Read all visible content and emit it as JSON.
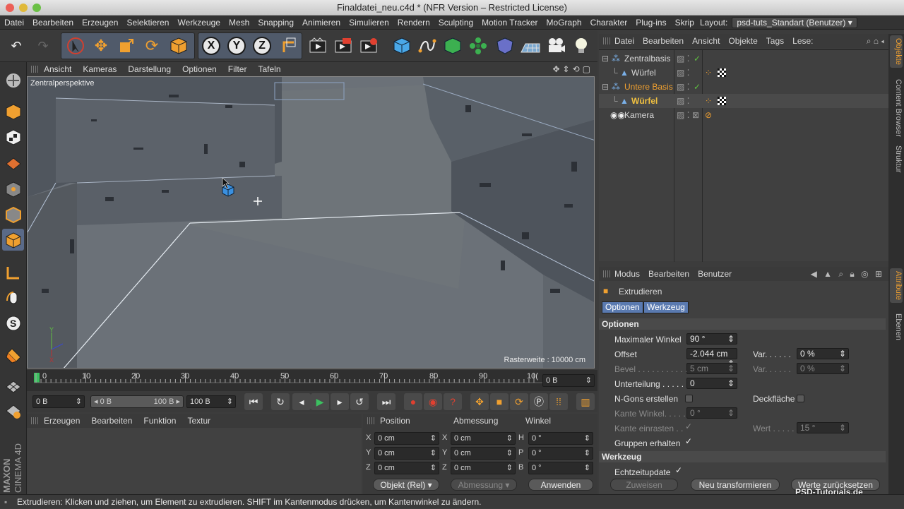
{
  "window": {
    "title": "Finaldatei_neu.c4d * (NFR Version – Restricted License)"
  },
  "menubar": {
    "items": [
      "Datei",
      "Bearbeiten",
      "Erzeugen",
      "Selektieren",
      "Werkzeuge",
      "Mesh",
      "Snapping",
      "Animieren",
      "Simulieren",
      "Rendern",
      "Sculpting",
      "Motion Tracker",
      "MoGraph",
      "Charakter",
      "Plug-ins",
      "Skrip"
    ],
    "layout_label": "Layout:",
    "layout_value": "psd-tuts_Standart (Benutzer)"
  },
  "toolbar": {
    "x": "X",
    "y": "Y",
    "z": "Z"
  },
  "viewport": {
    "menu": [
      "Ansicht",
      "Kameras",
      "Darstellung",
      "Optionen",
      "Filter",
      "Tafeln"
    ],
    "camera_label": "Zentralperspektive",
    "grid_label": "Rasterweite : 10000 cm"
  },
  "timeline": {
    "ticks": [
      "0",
      "10",
      "20",
      "30",
      "40",
      "50",
      "60",
      "70",
      "80",
      "90",
      "10("
    ],
    "current_frame": "0 B",
    "start_field": "0 B",
    "range_start": "◂ 0 B",
    "range_end": "100 B ▸",
    "end_field": "100 B"
  },
  "material_manager": {
    "menu": [
      "Erzeugen",
      "Bearbeiten",
      "Funktion",
      "Textur"
    ]
  },
  "coordinates": {
    "headers": [
      "Position",
      "Abmessung",
      "Winkel"
    ],
    "rows": [
      {
        "a": "X",
        "av": "0 cm",
        "b": "X",
        "bv": "0 cm",
        "c": "H",
        "cv": "0 °"
      },
      {
        "a": "Y",
        "av": "0 cm",
        "b": "Y",
        "bv": "0 cm",
        "c": "P",
        "cv": "0 °"
      },
      {
        "a": "Z",
        "av": "0 cm",
        "b": "Z",
        "bv": "0 cm",
        "c": "B",
        "cv": "0 °"
      }
    ],
    "mode": "Objekt (Rel)",
    "size_mode": "Abmessung",
    "apply": "Anwenden"
  },
  "object_manager": {
    "menu": [
      "Datei",
      "Bearbeiten",
      "Ansicht",
      "Objekte",
      "Tags",
      "Lese:"
    ],
    "objects": [
      {
        "name": "Zentralbasis",
        "indent": 0,
        "color": "#e0e0e0"
      },
      {
        "name": "Würfel",
        "indent": 1,
        "color": "#e0e0e0"
      },
      {
        "name": "Untere Basis",
        "indent": 0,
        "color": "#f0a030"
      },
      {
        "name": "Würfel",
        "indent": 1,
        "color": "#f0c040"
      },
      {
        "name": "Kamera",
        "indent": 0,
        "color": "#e0e0e0"
      }
    ]
  },
  "attributes": {
    "menu": [
      "Modus",
      "Bearbeiten",
      "Benutzer"
    ],
    "tool_name": "Extrudieren",
    "tabs": [
      "Optionen",
      "Werkzeug"
    ],
    "section_options": "Optionen",
    "max_angle_label": "Maximaler Winkel",
    "max_angle_value": "90 °",
    "offset_label": "Offset",
    "offset_value": "-2.044 cm",
    "var_label": "Var. . . . . .",
    "var_value": "0 %",
    "bevel_label": "Bevel . . . . . . . . . . . .",
    "bevel_value": "5 cm",
    "var2_label": "Var. . . . . .",
    "var2_value": "0 %",
    "subdiv_label": "Unterteilung . . . . .",
    "subdiv_value": "0",
    "ngons_label": "N-Gons erstellen",
    "cap_label": "Deckfläche",
    "edge_angle_label": "Kante Winkel. . . . .",
    "edge_angle_value": "0 °",
    "edge_snap_label": "Kante einrasten . .",
    "wert_label": "Wert . . . . . .",
    "wert_value": "15 °",
    "keep_groups_label": "Gruppen erhalten",
    "section_tool": "Werkzeug",
    "realtime_label": "Echtzeitupdate",
    "assign_button": "Zuweisen",
    "new_transform_button": "Neu transformieren",
    "reset_button": "Werte zurücksetzen"
  },
  "right_tabs": [
    "Objekte",
    "Content Browser",
    "Struktur",
    "Attribute",
    "Ebenen"
  ],
  "branding": {
    "maxon": "MAXON",
    "c4d": "CINEMA 4D",
    "watermark": "PSD-Tutorials.de"
  },
  "status": "Extrudieren: Klicken und ziehen, um Element zu extrudieren. SHIFT im Kantenmodus drücken, um Kantenwinkel zu ändern.",
  "colors": {
    "accent_orange": "#f0a030",
    "selection_blue": "#5a7ab0",
    "play_green": "#3cc060"
  },
  "icons": [
    "undo-icon",
    "redo-icon",
    "select-arrow-icon",
    "move-icon",
    "scale-icon",
    "rotate-icon",
    "cube-icon",
    "coordinate-system-icon",
    "render-region-icon",
    "render-view-icon",
    "render-settings-icon",
    "cube-primitive-icon",
    "spline-icon",
    "nurbs-icon",
    "array-icon",
    "deformer-icon",
    "floor-icon",
    "camera-icon",
    "light-icon"
  ]
}
